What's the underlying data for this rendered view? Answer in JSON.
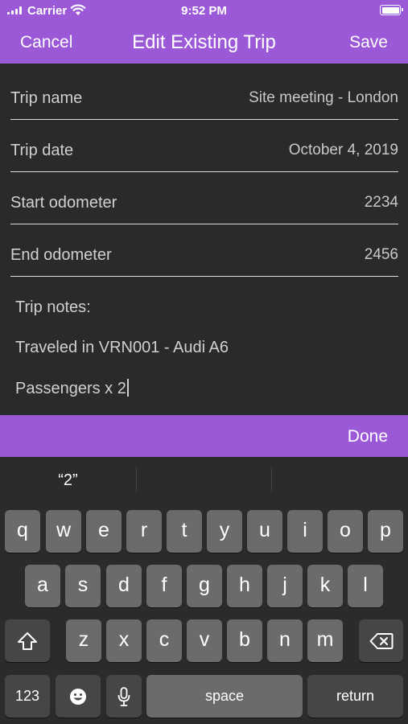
{
  "status_bar": {
    "carrier": "Carrier",
    "time": "9:52 PM"
  },
  "nav": {
    "cancel": "Cancel",
    "title": "Edit Existing Trip",
    "save": "Save"
  },
  "form": {
    "rows": [
      {
        "label": "Trip name",
        "value": "Site meeting - London"
      },
      {
        "label": "Trip date",
        "value": "October 4, 2019"
      },
      {
        "label": "Start odometer",
        "value": "2234"
      },
      {
        "label": "End odometer",
        "value": "2456"
      }
    ],
    "notes": {
      "label": "Trip notes:",
      "line1": "Traveled in VRN001 - Audi A6",
      "line2": "Passengers x 2"
    }
  },
  "toolbar": {
    "done": "Done"
  },
  "keyboard": {
    "suggestions": [
      "“2”",
      "",
      ""
    ],
    "row1": [
      "q",
      "w",
      "e",
      "r",
      "t",
      "y",
      "u",
      "i",
      "o",
      "p"
    ],
    "row2": [
      "a",
      "s",
      "d",
      "f",
      "g",
      "h",
      "j",
      "k",
      "l"
    ],
    "row3": [
      "z",
      "x",
      "c",
      "v",
      "b",
      "n",
      "m"
    ],
    "numbers_key": "123",
    "space_key": "space",
    "return_key": "return",
    "icons": [
      "shift-icon",
      "backspace-icon",
      "emoji-icon",
      "microphone-icon"
    ]
  }
}
